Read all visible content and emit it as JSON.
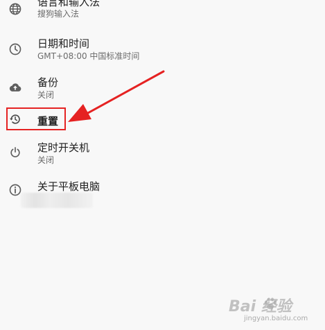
{
  "settings": {
    "language": {
      "title": "语言和输入法",
      "subtitle": "搜狗输入法",
      "icon": "globe-icon"
    },
    "datetime": {
      "title": "日期和时间",
      "subtitle": "GMT+08:00 中国标准时间",
      "icon": "clock-icon"
    },
    "backup": {
      "title": "备份",
      "subtitle": "关闭",
      "icon": "cloud-upload-icon"
    },
    "reset": {
      "title": "重置",
      "icon": "restore-icon"
    },
    "schedule_power": {
      "title": "定时开关机",
      "subtitle": "关闭",
      "icon": "power-schedule-icon"
    },
    "about": {
      "title": "关于平板电脑",
      "icon": "info-icon"
    }
  },
  "annotation": {
    "highlight_color": "#e52222",
    "arrow_color": "#e52222"
  },
  "watermark": {
    "brand": "Bai 经验",
    "url": "jingyan.baidu.com"
  }
}
